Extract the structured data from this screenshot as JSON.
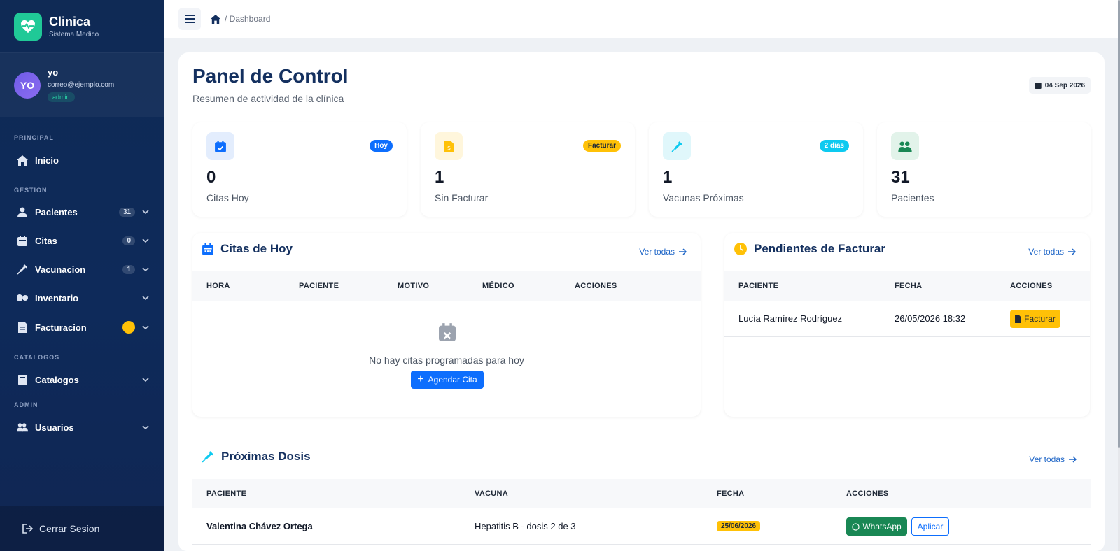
{
  "brand": {
    "title": "Clinica",
    "subtitle": "Sistema Medico"
  },
  "user": {
    "initials": "YO",
    "name": "yo",
    "email": "correo@ejemplo.com",
    "role": "admin"
  },
  "sidebar": {
    "sections": {
      "principal": "PRINCIPAL",
      "gestion": "GESTION",
      "catalogos": "CATALOGOS",
      "admin": "ADMIN"
    },
    "items": [
      {
        "label": "Inicio"
      },
      {
        "label": "Pacientes",
        "badge": "31"
      },
      {
        "label": "Citas",
        "badge": "0"
      },
      {
        "label": "Vacunacion",
        "badge": "1"
      },
      {
        "label": "Inventario"
      },
      {
        "label": "Facturacion"
      },
      {
        "label": "Catalogos"
      },
      {
        "label": "Usuarios"
      }
    ],
    "logout": "Cerrar Sesion"
  },
  "topbar": {
    "breadcrumb": "/ Dashboard"
  },
  "page": {
    "title": "Panel de Control",
    "subtitle": "Resumen de actividad de la clínica",
    "date": "04 Sep 2026"
  },
  "stats": [
    {
      "value": "0",
      "label": "Citas Hoy",
      "badge": "Hoy",
      "badge_color": "#0d6efd"
    },
    {
      "value": "1",
      "label": "Sin Facturar",
      "badge": "Facturar",
      "badge_color": "#ffc107"
    },
    {
      "value": "1",
      "label": "Vacunas Próximas",
      "badge": "2 días",
      "badge_color": "#0dcaf0"
    },
    {
      "value": "31",
      "label": "Pacientes",
      "badge": ""
    }
  ],
  "citas": {
    "title": "Citas de Hoy",
    "link": "Ver todas",
    "columns": [
      "HORA",
      "PACIENTE",
      "MOTIVO",
      "MÉDICO",
      "ACCIONES"
    ],
    "empty_text": "No hay citas programadas para hoy",
    "action": "Agendar Cita"
  },
  "pendientes": {
    "title": "Pendientes de Facturar",
    "link": "Ver todas",
    "columns": [
      "PACIENTE",
      "FECHA",
      "ACCIONES"
    ],
    "rows": [
      {
        "paciente": "Lucía Ramírez Rodríguez",
        "fecha": "26/05/2026 18:32",
        "action": "Facturar"
      }
    ]
  },
  "dosis": {
    "title": "Próximas Dosis",
    "link": "Ver todas",
    "columns": [
      "PACIENTE",
      "VACUNA",
      "FECHA",
      "ACCIONES"
    ],
    "rows": [
      {
        "paciente": "Valentina Chávez Ortega",
        "vacuna": "Hepatitis B - dosis 2 de 3",
        "fecha": "25/06/2026",
        "whatsapp": "WhatsApp",
        "aplicar": "Aplicar"
      }
    ]
  },
  "colors": {
    "primary": "#0d6efd",
    "accent": "#20c997",
    "warning": "#ffc107",
    "sidebar": "#0f2a55",
    "title": "#14305f"
  }
}
